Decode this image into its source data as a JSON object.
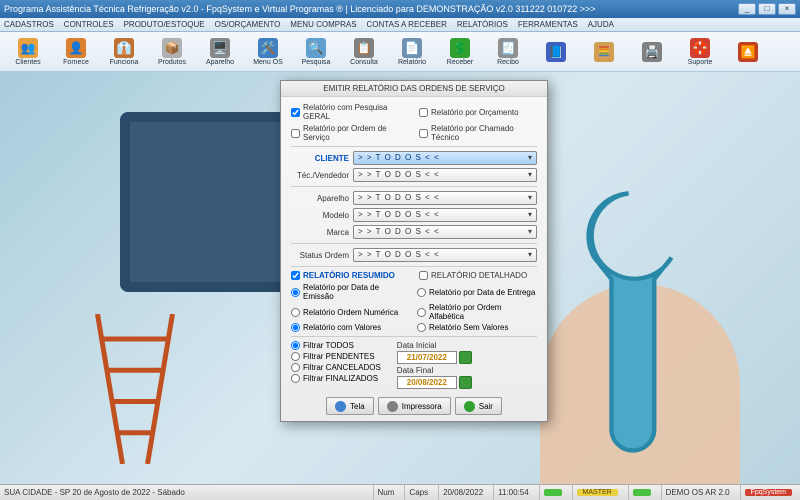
{
  "window": {
    "title": "Programa Assistência Técnica Refrigeração v2.0 - FpqSystem e Virtual Programas ® | Licenciado para  DEMONSTRAÇÃO v2.0 311222 010722 >>>"
  },
  "menu": {
    "items": [
      "CADASTROS",
      "CONTROLES",
      "PRODUTO/ESTOQUE",
      "OS/ORÇAMENTO",
      "MENU COMPRAS",
      "CONTAS A RECEBER",
      "RELATÓRIOS",
      "FERRAMENTAS",
      "AJUDA"
    ]
  },
  "toolbar": {
    "buttons": [
      {
        "label": "Clientes",
        "icon": "👥",
        "bg": "#e8a040"
      },
      {
        "label": "Fornece",
        "icon": "👤",
        "bg": "#d88030"
      },
      {
        "label": "Funciona",
        "icon": "👔",
        "bg": "#c07030"
      },
      {
        "label": "Produtos",
        "icon": "📦",
        "bg": "#b0b0b0"
      },
      {
        "label": "Aparelho",
        "icon": "🖥️",
        "bg": "#888"
      },
      {
        "label": "Menu OS",
        "icon": "🛠️",
        "bg": "#4080c0"
      },
      {
        "label": "Pesquisa",
        "icon": "🔍",
        "bg": "#60a0d0"
      },
      {
        "label": "Consulta",
        "icon": "📋",
        "bg": "#808080"
      },
      {
        "label": "Relatório",
        "icon": "📄",
        "bg": "#7090b0"
      },
      {
        "label": "Receber",
        "icon": "💲",
        "bg": "#30a030"
      },
      {
        "label": "Recibo",
        "icon": "🧾",
        "bg": "#909090"
      },
      {
        "label": "",
        "icon": "📘",
        "bg": "#4060c0"
      },
      {
        "label": "",
        "icon": "🧮",
        "bg": "#d0a050"
      },
      {
        "label": "",
        "icon": "🖨️",
        "bg": "#808080"
      },
      {
        "label": "Suporte",
        "icon": "🛟",
        "bg": "#d04030"
      },
      {
        "label": "",
        "icon": "⏏️",
        "bg": "#c04020"
      }
    ]
  },
  "dialog": {
    "title": "EMITIR RELATÓRIO DAS ORDENS DE SERVIÇO",
    "checks1": [
      {
        "label": "Relatório com Pesquisa GERAL",
        "checked": true
      },
      {
        "label": "Relatório por Orçamento",
        "checked": false
      },
      {
        "label": "Relatório por Ordem de Serviço",
        "checked": false
      },
      {
        "label": "Relatório por Chamado Técnico",
        "checked": false
      }
    ],
    "fields": {
      "cliente_label": "CLIENTE",
      "cliente_value": "> >  T O D O S  < <",
      "tec_label": "Téc./Vendedor",
      "tec_value": "> >  T O D O S  < <",
      "aparelho_label": "Aparelho",
      "aparelho_value": "> >  T O D O S  < <",
      "modelo_label": "Modelo",
      "modelo_value": "> >  T O D O S  < <",
      "marca_label": "Marca",
      "marca_value": "> >  T O D O S  < <",
      "status_label": "Status Ordem",
      "status_value": "> >  T O D O S  < <"
    },
    "resumo": {
      "resumido": "RELATÓRIO RESUMIDO",
      "detalhado": "RELATÓRIO DETALHADO"
    },
    "radios": [
      {
        "label": "Relatório por Data de Emissão",
        "checked": true
      },
      {
        "label": "Relatório por Data de Entrega",
        "checked": false
      },
      {
        "label": "Relatório Ordem Numérica",
        "checked": false
      },
      {
        "label": "Relatório por Ordem Alfabética",
        "checked": false
      },
      {
        "label": "Relatório com Valores",
        "checked": true
      },
      {
        "label": "Relatório Sem Valores",
        "checked": false
      }
    ],
    "filters": [
      {
        "label": "Filtrar TODOS",
        "checked": true
      },
      {
        "label": "Filtrar PENDENTES",
        "checked": false
      },
      {
        "label": "Filtrar CANCELADOS",
        "checked": false
      },
      {
        "label": "Filtrar FINALIZADOS",
        "checked": false
      }
    ],
    "dates": {
      "initial_label": "Data Inicial",
      "initial_value": "21/07/2022",
      "final_label": "Data Final",
      "final_value": "20/08/2022"
    },
    "buttons": {
      "tela": "Tela",
      "impressora": "Impressora",
      "sair": "Sair"
    }
  },
  "status": {
    "left": "SUA CIDADE - SP 20 de Agosto de 2022 - Sábado",
    "num": "Num",
    "caps": "Caps",
    "date": "20/08/2022",
    "time": "11:00:54",
    "badge1": "",
    "badge2": "MASTER",
    "badge3": "",
    "demo": "DEMO OS AR 2.0",
    "brand": "FpqSystem"
  }
}
